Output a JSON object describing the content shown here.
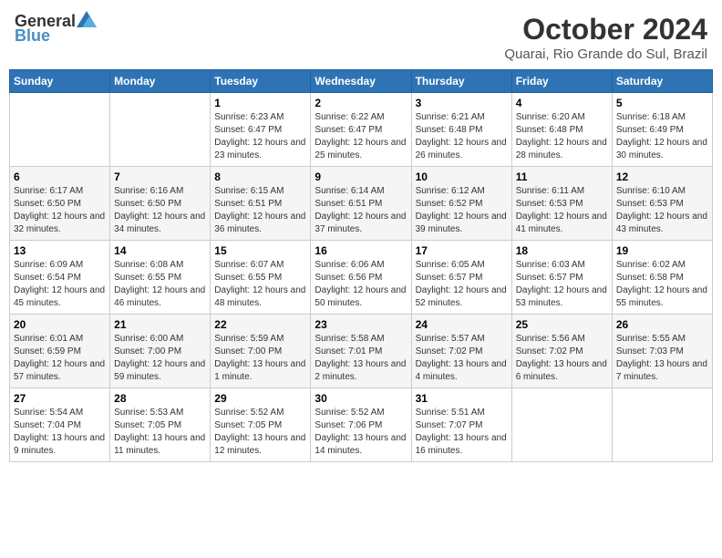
{
  "header": {
    "logo_general": "General",
    "logo_blue": "Blue",
    "month_title": "October 2024",
    "location": "Quarai, Rio Grande do Sul, Brazil"
  },
  "days_of_week": [
    "Sunday",
    "Monday",
    "Tuesday",
    "Wednesday",
    "Thursday",
    "Friday",
    "Saturday"
  ],
  "weeks": [
    [
      {
        "day": "",
        "content": ""
      },
      {
        "day": "",
        "content": ""
      },
      {
        "day": "1",
        "content": "Sunrise: 6:23 AM\nSunset: 6:47 PM\nDaylight: 12 hours and 23 minutes."
      },
      {
        "day": "2",
        "content": "Sunrise: 6:22 AM\nSunset: 6:47 PM\nDaylight: 12 hours and 25 minutes."
      },
      {
        "day": "3",
        "content": "Sunrise: 6:21 AM\nSunset: 6:48 PM\nDaylight: 12 hours and 26 minutes."
      },
      {
        "day": "4",
        "content": "Sunrise: 6:20 AM\nSunset: 6:48 PM\nDaylight: 12 hours and 28 minutes."
      },
      {
        "day": "5",
        "content": "Sunrise: 6:18 AM\nSunset: 6:49 PM\nDaylight: 12 hours and 30 minutes."
      }
    ],
    [
      {
        "day": "6",
        "content": "Sunrise: 6:17 AM\nSunset: 6:50 PM\nDaylight: 12 hours and 32 minutes."
      },
      {
        "day": "7",
        "content": "Sunrise: 6:16 AM\nSunset: 6:50 PM\nDaylight: 12 hours and 34 minutes."
      },
      {
        "day": "8",
        "content": "Sunrise: 6:15 AM\nSunset: 6:51 PM\nDaylight: 12 hours and 36 minutes."
      },
      {
        "day": "9",
        "content": "Sunrise: 6:14 AM\nSunset: 6:51 PM\nDaylight: 12 hours and 37 minutes."
      },
      {
        "day": "10",
        "content": "Sunrise: 6:12 AM\nSunset: 6:52 PM\nDaylight: 12 hours and 39 minutes."
      },
      {
        "day": "11",
        "content": "Sunrise: 6:11 AM\nSunset: 6:53 PM\nDaylight: 12 hours and 41 minutes."
      },
      {
        "day": "12",
        "content": "Sunrise: 6:10 AM\nSunset: 6:53 PM\nDaylight: 12 hours and 43 minutes."
      }
    ],
    [
      {
        "day": "13",
        "content": "Sunrise: 6:09 AM\nSunset: 6:54 PM\nDaylight: 12 hours and 45 minutes."
      },
      {
        "day": "14",
        "content": "Sunrise: 6:08 AM\nSunset: 6:55 PM\nDaylight: 12 hours and 46 minutes."
      },
      {
        "day": "15",
        "content": "Sunrise: 6:07 AM\nSunset: 6:55 PM\nDaylight: 12 hours and 48 minutes."
      },
      {
        "day": "16",
        "content": "Sunrise: 6:06 AM\nSunset: 6:56 PM\nDaylight: 12 hours and 50 minutes."
      },
      {
        "day": "17",
        "content": "Sunrise: 6:05 AM\nSunset: 6:57 PM\nDaylight: 12 hours and 52 minutes."
      },
      {
        "day": "18",
        "content": "Sunrise: 6:03 AM\nSunset: 6:57 PM\nDaylight: 12 hours and 53 minutes."
      },
      {
        "day": "19",
        "content": "Sunrise: 6:02 AM\nSunset: 6:58 PM\nDaylight: 12 hours and 55 minutes."
      }
    ],
    [
      {
        "day": "20",
        "content": "Sunrise: 6:01 AM\nSunset: 6:59 PM\nDaylight: 12 hours and 57 minutes."
      },
      {
        "day": "21",
        "content": "Sunrise: 6:00 AM\nSunset: 7:00 PM\nDaylight: 12 hours and 59 minutes."
      },
      {
        "day": "22",
        "content": "Sunrise: 5:59 AM\nSunset: 7:00 PM\nDaylight: 13 hours and 1 minute."
      },
      {
        "day": "23",
        "content": "Sunrise: 5:58 AM\nSunset: 7:01 PM\nDaylight: 13 hours and 2 minutes."
      },
      {
        "day": "24",
        "content": "Sunrise: 5:57 AM\nSunset: 7:02 PM\nDaylight: 13 hours and 4 minutes."
      },
      {
        "day": "25",
        "content": "Sunrise: 5:56 AM\nSunset: 7:02 PM\nDaylight: 13 hours and 6 minutes."
      },
      {
        "day": "26",
        "content": "Sunrise: 5:55 AM\nSunset: 7:03 PM\nDaylight: 13 hours and 7 minutes."
      }
    ],
    [
      {
        "day": "27",
        "content": "Sunrise: 5:54 AM\nSunset: 7:04 PM\nDaylight: 13 hours and 9 minutes."
      },
      {
        "day": "28",
        "content": "Sunrise: 5:53 AM\nSunset: 7:05 PM\nDaylight: 13 hours and 11 minutes."
      },
      {
        "day": "29",
        "content": "Sunrise: 5:52 AM\nSunset: 7:05 PM\nDaylight: 13 hours and 12 minutes."
      },
      {
        "day": "30",
        "content": "Sunrise: 5:52 AM\nSunset: 7:06 PM\nDaylight: 13 hours and 14 minutes."
      },
      {
        "day": "31",
        "content": "Sunrise: 5:51 AM\nSunset: 7:07 PM\nDaylight: 13 hours and 16 minutes."
      },
      {
        "day": "",
        "content": ""
      },
      {
        "day": "",
        "content": ""
      }
    ]
  ]
}
